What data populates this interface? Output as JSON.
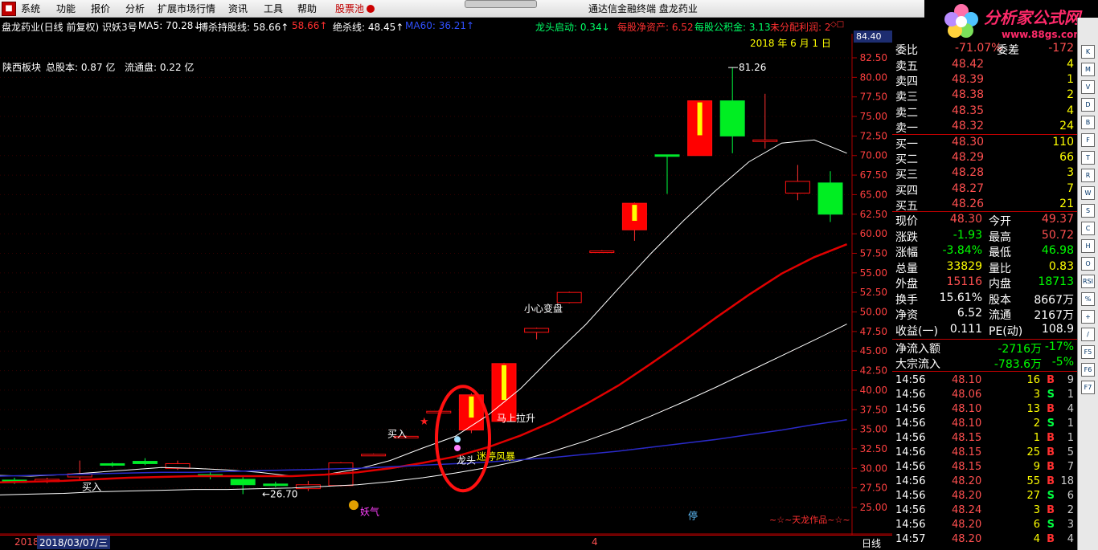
{
  "menu": {
    "items": [
      "系统",
      "功能",
      "报价",
      "分析",
      "扩展市场行情",
      "资讯",
      "工具",
      "帮助"
    ],
    "stock_pool": "股票池",
    "title": "通达信金融终端    盘龙药业"
  },
  "logo": {
    "title": "分析家公式网",
    "url": "www.88gs.com"
  },
  "info_bar": {
    "stock": "盘龙药业(日线 前复权) 识妖3号",
    "ma5": "MA5: 70.28↓",
    "kill_hold": "搏杀持股线: 58.66↑",
    "kill_hold_val2": "58.66↑",
    "kill_line": "绝杀线: 48.45↑",
    "ma60": "MA60: 36.21↑",
    "dragon_start": "龙头启动: 0.34↓",
    "net_asset": "每股净资产: 6.52",
    "reserve": "每股公积金: 3.13",
    "undistributed": "未分配利润: 2",
    "date": "2018 年 6 月 1 日",
    "current_axis": "84.40"
  },
  "chart_overlay": {
    "sector": "陕西板块",
    "total_shares": "总股本: 0.87 亿",
    "float_shares": "流通盘: 0.22 亿",
    "signature": "~☆~天龙作品~☆~",
    "peak_label": "81.26",
    "low_label": "26.70"
  },
  "chart_data": {
    "type": "candlestick",
    "y_axis": {
      "min": 25.0,
      "max": 82.5,
      "ticks": [
        "82.50",
        "80.00",
        "77.50",
        "75.00",
        "72.50",
        "70.00",
        "67.50",
        "65.00",
        "62.50",
        "60.00",
        "57.50",
        "55.00",
        "52.50",
        "50.00",
        "47.50",
        "45.00",
        "42.50",
        "40.00",
        "37.50",
        "35.00",
        "32.50",
        "30.00",
        "27.50",
        "25.00"
      ]
    },
    "candles": [
      {
        "o": 28.5,
        "c": 28.2,
        "h": 28.8,
        "l": 28.0
      },
      {
        "o": 28.3,
        "c": 28.6,
        "h": 28.8,
        "l": 28.1
      },
      {
        "o": 28.9,
        "c": 29.3,
        "h": 31.0,
        "l": 28.6
      },
      {
        "o": 30.6,
        "c": 30.4,
        "h": 30.8,
        "l": 30.2
      },
      {
        "o": 30.9,
        "c": 30.6,
        "h": 31.3,
        "l": 30.4
      },
      {
        "o": 30.0,
        "c": 30.6,
        "h": 31.0,
        "l": 29.8
      },
      {
        "o": 29.2,
        "c": 29.0,
        "h": 29.6,
        "l": 28.6
      },
      {
        "o": 28.6,
        "c": 27.9,
        "h": 29.0,
        "l": 26.7
      },
      {
        "o": 28.0,
        "c": 27.9,
        "h": 28.3,
        "l": 27.6
      },
      {
        "o": 27.4,
        "c": 27.9,
        "h": 28.4,
        "l": 27.1
      },
      {
        "o": 27.8,
        "c": 30.7,
        "h": 30.8,
        "l": 27.7
      },
      {
        "o": 31.8,
        "c": 31.8,
        "h": 31.9,
        "l": 31.7
      },
      {
        "o": 34.0,
        "c": 34.1,
        "h": 34.2,
        "l": 33.9
      },
      {
        "o": 37.2,
        "c": 37.3,
        "h": 37.4,
        "l": 37.1
      },
      {
        "o": 34.9,
        "c": 39.4,
        "h": 39.6,
        "l": 34.5
      },
      {
        "o": 36.0,
        "c": 43.4,
        "h": 43.5,
        "l": 35.8
      },
      {
        "o": 47.4,
        "c": 47.9,
        "h": 48.0,
        "l": 46.5
      },
      {
        "o": 51.2,
        "c": 52.5,
        "h": 52.6,
        "l": 51.1
      },
      {
        "o": 57.8,
        "c": 57.8,
        "h": 57.9,
        "l": 57.7
      },
      {
        "o": 60.5,
        "c": 63.9,
        "h": 64.0,
        "l": 59.1
      },
      {
        "o": 70.1,
        "c": 70.0,
        "h": 70.1,
        "l": 65.1
      },
      {
        "o": 70.0,
        "c": 77.0,
        "h": 77.0,
        "l": 70.0
      },
      {
        "o": 77.0,
        "c": 72.5,
        "h": 81.26,
        "l": 70.3
      },
      {
        "o": 72.0,
        "c": 72.0,
        "h": 77.9,
        "l": 70.9
      },
      {
        "o": 65.2,
        "c": 66.7,
        "h": 68.8,
        "l": 64.3
      },
      {
        "o": 66.5,
        "c": 62.5,
        "h": 68.0,
        "l": 61.5
      }
    ],
    "ma5": [
      29.1,
      29.0,
      29.2,
      29.5,
      29.8,
      30.1,
      30.0,
      29.8,
      29.5,
      29.0,
      29.2,
      29.9,
      31.0,
      32.6,
      34.1,
      36.8,
      40.2,
      44.4,
      48.4,
      53.0,
      57.5,
      61.7,
      65.6,
      69.2,
      71.6,
      72.0,
      70.3
    ],
    "ma_red": [
      28.2,
      28.3,
      28.4,
      28.6,
      28.8,
      28.9,
      29.0,
      29.0,
      29.0,
      29.0,
      29.2,
      29.5,
      30.0,
      30.7,
      31.5,
      32.7,
      34.2,
      36.0,
      38.2,
      40.6,
      43.4,
      46.3,
      49.3,
      52.2,
      54.9,
      57.0,
      58.66
    ],
    "ma_white2": [
      26.6,
      26.7,
      26.8,
      27.0,
      27.1,
      27.2,
      27.3,
      27.3,
      27.4,
      27.5,
      27.7,
      27.9,
      28.3,
      28.8,
      29.4,
      30.1,
      31.0,
      32.2,
      33.5,
      35.0,
      36.7,
      38.5,
      40.4,
      42.4,
      44.4,
      46.4,
      48.45
    ],
    "ma60": [
      29.0,
      29.1,
      29.2,
      29.3,
      29.4,
      29.5,
      29.5,
      29.6,
      29.7,
      29.8,
      29.9,
      30.0,
      30.2,
      30.4,
      30.6,
      30.8,
      31.1,
      31.4,
      31.8,
      32.2,
      32.7,
      33.2,
      33.7,
      34.3,
      34.9,
      35.6,
      36.21
    ],
    "annotations": [
      "买入",
      "买入",
      "妖气",
      "马上拉升",
      "小心变盘",
      "迷停风暴",
      "龙头",
      "停"
    ]
  },
  "side_panel": {
    "header": {
      "label1": "委比",
      "value1": "-71.07%",
      "label2": "委差",
      "value2": "-172"
    },
    "asks": [
      {
        "label": "卖五",
        "price": "48.42",
        "vol": "4"
      },
      {
        "label": "卖四",
        "price": "48.39",
        "vol": "1"
      },
      {
        "label": "卖三",
        "price": "48.38",
        "vol": "2"
      },
      {
        "label": "卖二",
        "price": "48.35",
        "vol": "4"
      },
      {
        "label": "卖一",
        "price": "48.32",
        "vol": "24"
      }
    ],
    "bids": [
      {
        "label": "买一",
        "price": "48.30",
        "vol": "110"
      },
      {
        "label": "买二",
        "price": "48.29",
        "vol": "66"
      },
      {
        "label": "买三",
        "price": "48.28",
        "vol": "3"
      },
      {
        "label": "买四",
        "price": "48.27",
        "vol": "7"
      },
      {
        "label": "买五",
        "price": "48.26",
        "vol": "21"
      }
    ],
    "quote": [
      {
        "l1": "现价",
        "v1": "48.30",
        "c1": "#ff5050",
        "l2": "今开",
        "v2": "49.37",
        "c2": "#ff5050"
      },
      {
        "l1": "涨跌",
        "v1": "-1.93",
        "c1": "#00ff00",
        "l2": "最高",
        "v2": "50.72",
        "c2": "#ff5050"
      },
      {
        "l1": "涨幅",
        "v1": "-3.84%",
        "c1": "#00ff00",
        "l2": "最低",
        "v2": "46.98",
        "c2": "#00ff00"
      },
      {
        "l1": "总量",
        "v1": "33829",
        "c1": "#ffff00",
        "l2": "量比",
        "v2": "0.83",
        "c2": "#ffff00"
      },
      {
        "l1": "外盘",
        "v1": "15116",
        "c1": "#ff5050",
        "l2": "内盘",
        "v2": "18713",
        "c2": "#00ff00"
      },
      {
        "l1": "换手",
        "v1": "15.61%",
        "c1": "#fff",
        "l2": "股本",
        "v2": "8667万",
        "c2": "#fff"
      },
      {
        "l1": "净资",
        "v1": "6.52",
        "c1": "#fff",
        "l2": "流通",
        "v2": "2167万",
        "c2": "#fff"
      },
      {
        "l1": "收益(一)",
        "v1": "0.111",
        "c1": "#fff",
        "l2": "PE(动)",
        "v2": "108.9",
        "c2": "#fff"
      }
    ],
    "flows": [
      {
        "label": "净流入额",
        "value": "-2716万",
        "pct": "-17%"
      },
      {
        "label": "大宗流入",
        "value": "-783.6万",
        "pct": "-5%"
      }
    ],
    "ticks": [
      {
        "t": "14:56",
        "p": "48.10",
        "v": "16",
        "bs": "B",
        "n": "9"
      },
      {
        "t": "14:56",
        "p": "48.06",
        "v": "3",
        "bs": "S",
        "n": "1"
      },
      {
        "t": "14:56",
        "p": "48.10",
        "v": "13",
        "bs": "B",
        "n": "4"
      },
      {
        "t": "14:56",
        "p": "48.10",
        "v": "2",
        "bs": "S",
        "n": "1"
      },
      {
        "t": "14:56",
        "p": "48.15",
        "v": "1",
        "bs": "B",
        "n": "1"
      },
      {
        "t": "14:56",
        "p": "48.15",
        "v": "25",
        "bs": "B",
        "n": "5"
      },
      {
        "t": "14:56",
        "p": "48.15",
        "v": "9",
        "bs": "B",
        "n": "7"
      },
      {
        "t": "14:56",
        "p": "48.20",
        "v": "55",
        "bs": "B",
        "n": "18"
      },
      {
        "t": "14:56",
        "p": "48.20",
        "v": "27",
        "bs": "S",
        "n": "6"
      },
      {
        "t": "14:56",
        "p": "48.24",
        "v": "3",
        "bs": "B",
        "n": "2"
      },
      {
        "t": "14:56",
        "p": "48.20",
        "v": "6",
        "bs": "S",
        "n": "3"
      },
      {
        "t": "14:57",
        "p": "48.20",
        "v": "4",
        "bs": "B",
        "n": "4"
      }
    ]
  },
  "bottom_bar": {
    "year": "2018",
    "date": "2018/03/07/三",
    "mark": "4",
    "period": "日线"
  },
  "toolbar_icons": [
    "K",
    "M",
    "V",
    "D",
    "B",
    "F",
    "T",
    "R",
    "W",
    "S",
    "C",
    "H",
    "O",
    "RSI",
    "%",
    "+",
    "/",
    "F5",
    "F6",
    "F7"
  ],
  "colors": {
    "up": "#ff0000",
    "down": "#00dd22",
    "doji_yellow": "#ffff00",
    "ma_white": "#ffffff",
    "ma_red": "#e00000",
    "ma60": "#2020c0"
  }
}
